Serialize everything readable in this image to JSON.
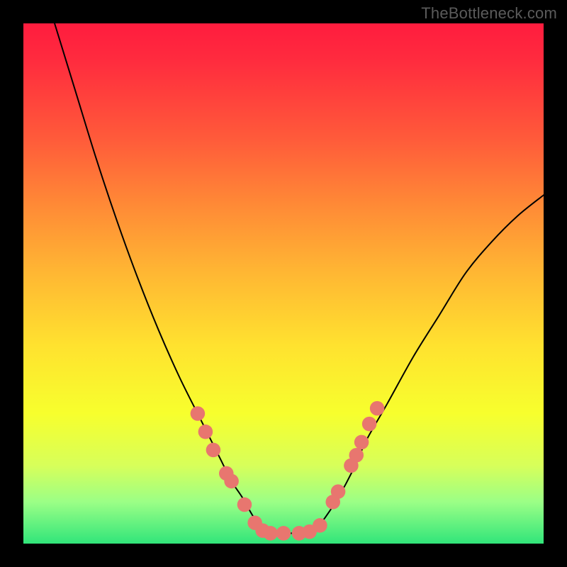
{
  "watermark": "TheBottleneck.com",
  "chart_data": {
    "type": "line",
    "title": "",
    "xlabel": "",
    "ylabel": "",
    "xlim": [
      0,
      100
    ],
    "ylim": [
      0,
      100
    ],
    "series": [
      {
        "name": "left-curve",
        "x": [
          6,
          10,
          14,
          18,
          22,
          26,
          30,
          34,
          36,
          38,
          40,
          42,
          44,
          46
        ],
        "y": [
          100,
          87,
          74,
          62,
          51,
          41,
          32,
          24,
          20,
          16,
          12,
          9,
          5.5,
          2.5
        ]
      },
      {
        "name": "flat-bottom",
        "x": [
          46,
          48,
          50,
          52,
          54,
          56
        ],
        "y": [
          2.5,
          2,
          2,
          2,
          2,
          2.5
        ]
      },
      {
        "name": "right-curve",
        "x": [
          56,
          58,
          60,
          62,
          64,
          66,
          70,
          75,
          80,
          85,
          90,
          95,
          100
        ],
        "y": [
          2.5,
          5,
          8,
          11.5,
          15.5,
          20,
          27,
          36,
          44,
          52,
          58,
          63,
          67
        ]
      }
    ],
    "scatter_points": {
      "name": "data-dots",
      "points": [
        {
          "x": 33.5,
          "y": 25
        },
        {
          "x": 35,
          "y": 21.5
        },
        {
          "x": 36.5,
          "y": 18
        },
        {
          "x": 39,
          "y": 13.5
        },
        {
          "x": 40,
          "y": 12
        },
        {
          "x": 42.5,
          "y": 7.5
        },
        {
          "x": 44.5,
          "y": 4
        },
        {
          "x": 46,
          "y": 2.5
        },
        {
          "x": 47.5,
          "y": 2
        },
        {
          "x": 50,
          "y": 2
        },
        {
          "x": 53,
          "y": 2
        },
        {
          "x": 55,
          "y": 2.3
        },
        {
          "x": 57,
          "y": 3.5
        },
        {
          "x": 59.5,
          "y": 8
        },
        {
          "x": 60.5,
          "y": 10
        },
        {
          "x": 63,
          "y": 15
        },
        {
          "x": 64,
          "y": 17
        },
        {
          "x": 65,
          "y": 19.5
        },
        {
          "x": 66.5,
          "y": 23
        },
        {
          "x": 68,
          "y": 26
        }
      ],
      "color": "#e8766f",
      "radius_norm": 1.4
    },
    "curve_color": "#000000",
    "curve_width": 2
  }
}
